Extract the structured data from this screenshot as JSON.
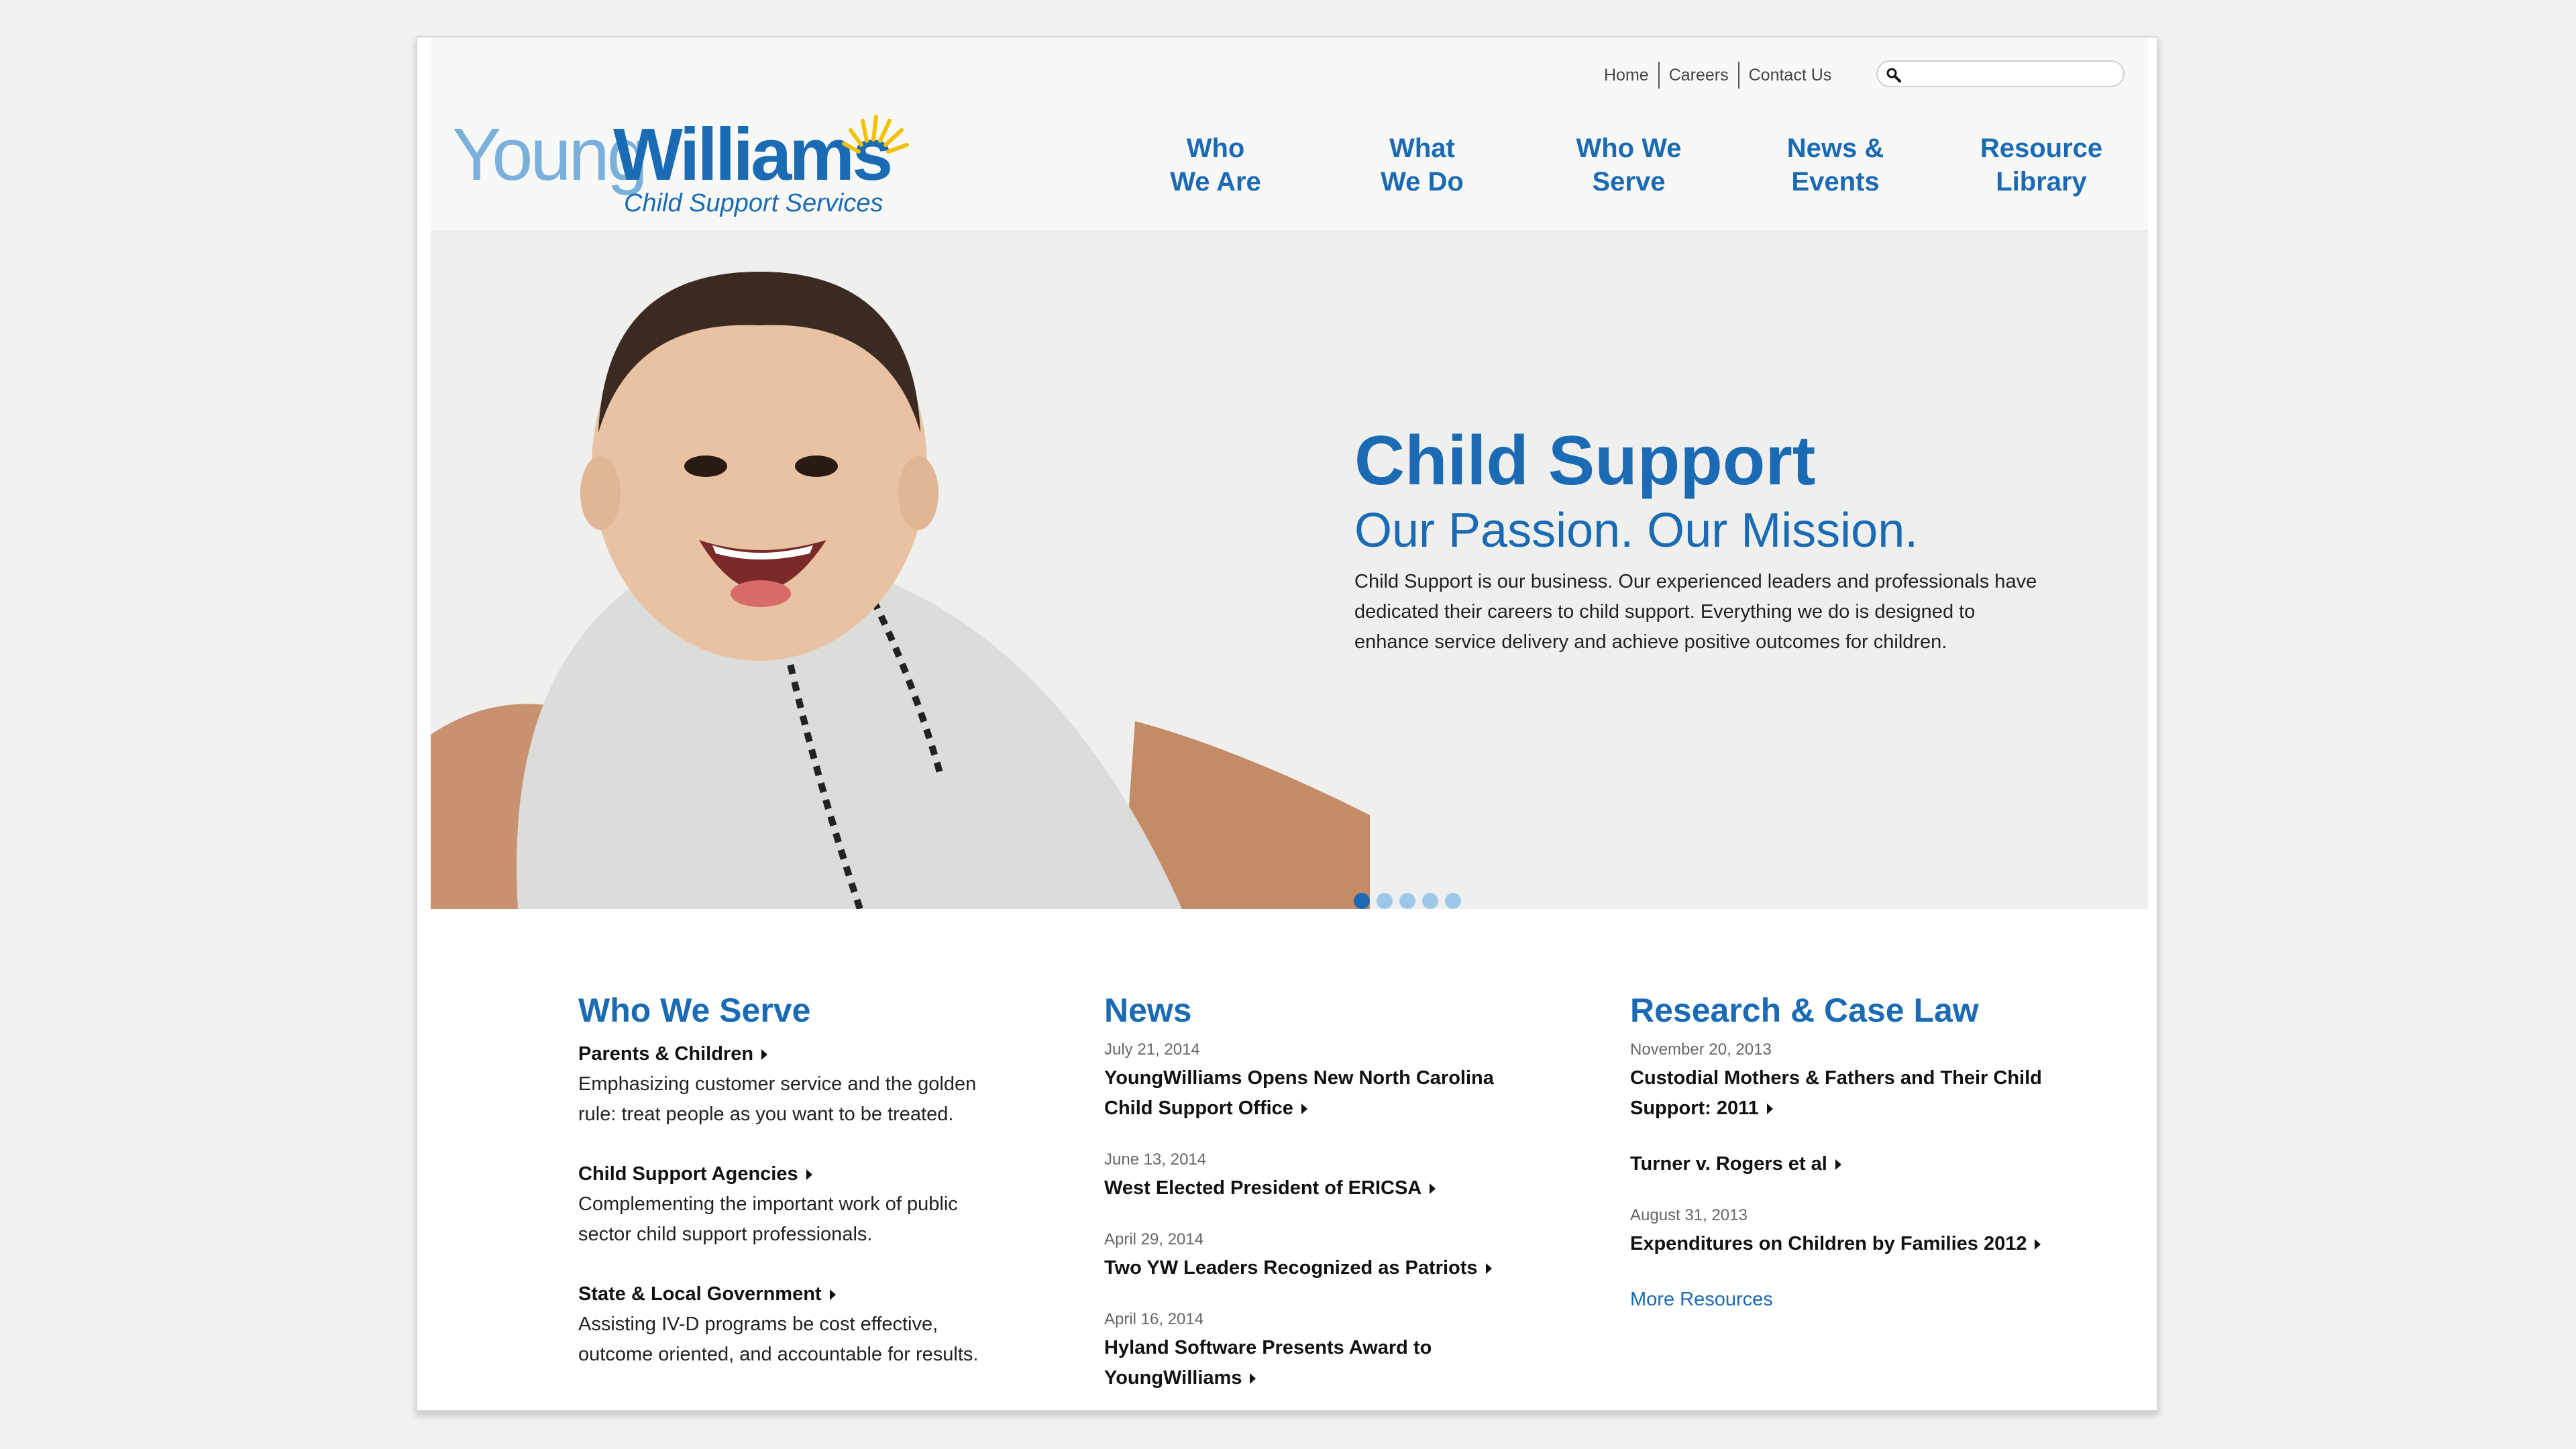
{
  "brand": {
    "logo_part1": "Young",
    "logo_part2": "Williams",
    "logo_subtitle": "Child Support Services",
    "colors": {
      "primary": "#1a6ab4",
      "light_blue": "#7ab0dc",
      "sun": "#f2c200"
    }
  },
  "utility_nav": {
    "home": "Home",
    "careers": "Careers",
    "contact": "Contact Us"
  },
  "search": {
    "placeholder": ""
  },
  "main_nav": [
    {
      "label": "Who\nWe Are"
    },
    {
      "label": "What\nWe Do"
    },
    {
      "label": "Who We\nServe"
    },
    {
      "label": "News &\nEvents"
    },
    {
      "label": "Resource\nLibrary"
    }
  ],
  "hero": {
    "title": "Child Support",
    "subtitle": "Our Passion. Our Mission.",
    "text": "Child Support is our business.  Our experienced leaders and professionals have dedicated their careers to child support.  Everything we do is designed to enhance service delivery and achieve positive outcomes for children.",
    "slide_count": 5,
    "active_slide": 1
  },
  "who_we_serve": {
    "title": "Who We Serve",
    "items": [
      {
        "title": "Parents & Children",
        "desc": "Emphasizing customer service and the golden rule: treat people as you want to be treated."
      },
      {
        "title": "Child Support Agencies",
        "desc": "Complementing the important work of public sector child support professionals."
      },
      {
        "title": "State & Local Government",
        "desc": "Assisting IV-D programs be cost effective, outcome oriented, and accountable for results."
      }
    ]
  },
  "news": {
    "title": "News",
    "items": [
      {
        "date": "July 21, 2014",
        "title": "YoungWilliams Opens New North Carolina Child Support Office"
      },
      {
        "date": "June 13, 2014",
        "title": "West Elected President of ERICSA"
      },
      {
        "date": "April 29, 2014",
        "title": "Two YW Leaders Recognized as Patriots"
      },
      {
        "date": "April 16, 2014",
        "title": "Hyland Software Presents Award to YoungWilliams"
      }
    ]
  },
  "research": {
    "title": "Research & Case Law",
    "items": [
      {
        "date": "November 20, 2013",
        "title": "Custodial Mothers & Fathers and Their Child Support: 2011"
      },
      {
        "date": "",
        "title": "Turner v. Rogers et al"
      },
      {
        "date": "August 31, 2013",
        "title": "Expenditures on Children by Families 2012"
      }
    ],
    "more_link": "More Resources"
  }
}
